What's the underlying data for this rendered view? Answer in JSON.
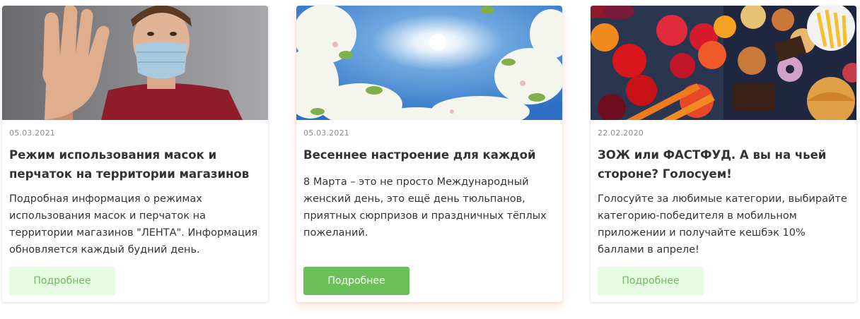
{
  "cards": [
    {
      "date": "05.03.2021",
      "title": "Режим использования масок и перчаток на территории магазинов",
      "description": "Подробная информация о режимах использования масок и перчаток на территории магазинов \"ЛЕНТА\". Информация обновляется каждый будний день.",
      "button_label": "Подробнее",
      "image": "man-in-mask-photo"
    },
    {
      "date": "05.03.2021",
      "title": "Весеннее настроение для каждой",
      "description": "8 Марта – это не просто Международный женский день, это ещё день тюльпанов, приятных сюрпризов и праздничных тёплых пожеланий.",
      "button_label": "Подробнее",
      "image": "spring-blossom-sky-photo"
    },
    {
      "date": "22.02.2020",
      "title": "ЗОЖ или ФАСТФУД. А вы на чьей стороне? Голосуем!",
      "description": "Голосуйте за любимые категории, выбирайте категорию-победителя в мобильном приложении и получайте кешбэк 10% баллами в апреле!",
      "button_label": "Подробнее",
      "image": "healthy-vs-fastfood-photo"
    }
  ],
  "colors": {
    "button_light_bg": "#e6fbdf",
    "button_light_text": "#6cbc58",
    "button_active_bg": "#6cc059",
    "button_active_text": "#ffffff"
  }
}
